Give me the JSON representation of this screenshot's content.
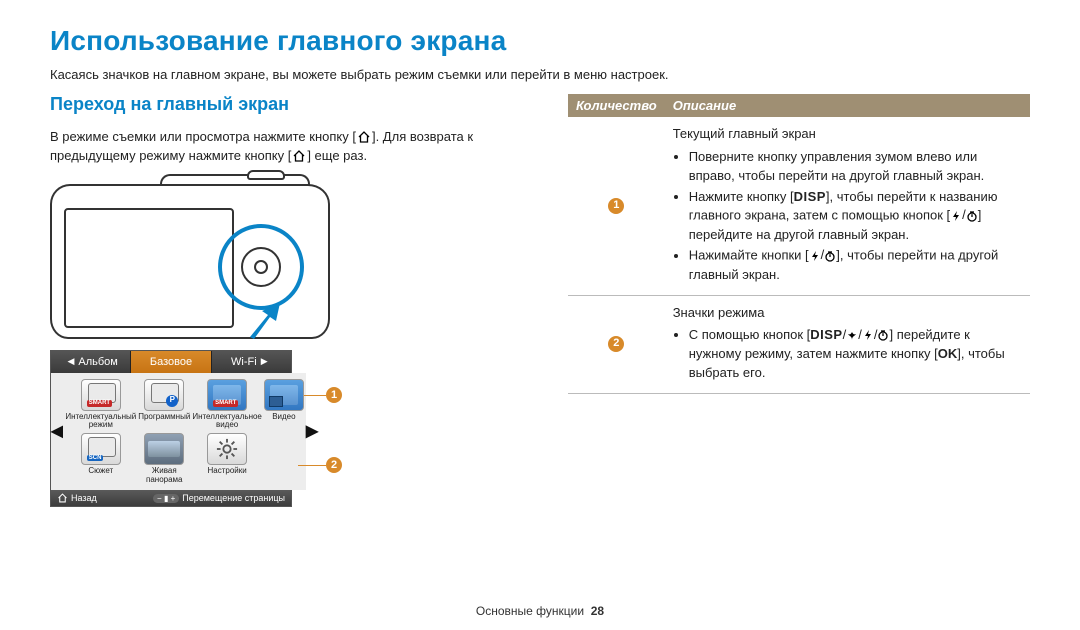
{
  "title": "Использование главного экрана",
  "lead": "Касаясь значков на главном экране, вы можете выбрать режим съемки или перейти в меню настроек.",
  "left": {
    "subheading": "Переход на главный экран",
    "intro_a": "В режиме съемки или просмотра нажмите кнопку [",
    "intro_b": "]. Для возврата к предыдущему режиму нажмите кнопку [",
    "intro_c": "] еще раз.",
    "tabs": {
      "album": "Альбом",
      "basic": "Базовое",
      "wifi": "Wi-Fi"
    },
    "modes": {
      "smart": "Интеллектуальный режим",
      "program": "Программный",
      "smart_video": "Интеллектуальное видео",
      "video": "Видео",
      "scene": "Сюжет",
      "panorama": "Живая панорама",
      "settings": "Настройки"
    },
    "bottombar": {
      "back": "Назад",
      "scroll": "Перемещение страницы"
    }
  },
  "table": {
    "head_qty": "Количество",
    "head_desc": "Описание",
    "row1": {
      "title": "Текущий главный экран",
      "b1": "Поверните кнопку управления зумом влево или вправо, чтобы перейти на другой главный экран.",
      "b2a": "Нажмите кнопку [",
      "b2_disp": "DISP",
      "b2b": "], чтобы перейти к названию главного экрана, затем с помощью кнопок [",
      "b2c": "] перейдите на другой главный экран.",
      "b3a": "Нажимайте кнопки [",
      "b3b": "], чтобы перейти на другой главный экран."
    },
    "row2": {
      "title": "Значки режима",
      "b1a": "С помощью кнопок [",
      "b1_disp": "DISP",
      "b1b": "] перейдите к нужному режиму, затем нажмите кнопку [",
      "b1_ok": "OK",
      "b1c": "], чтобы выбрать его."
    }
  },
  "footer": {
    "section": "Основные функции",
    "page": "28"
  }
}
